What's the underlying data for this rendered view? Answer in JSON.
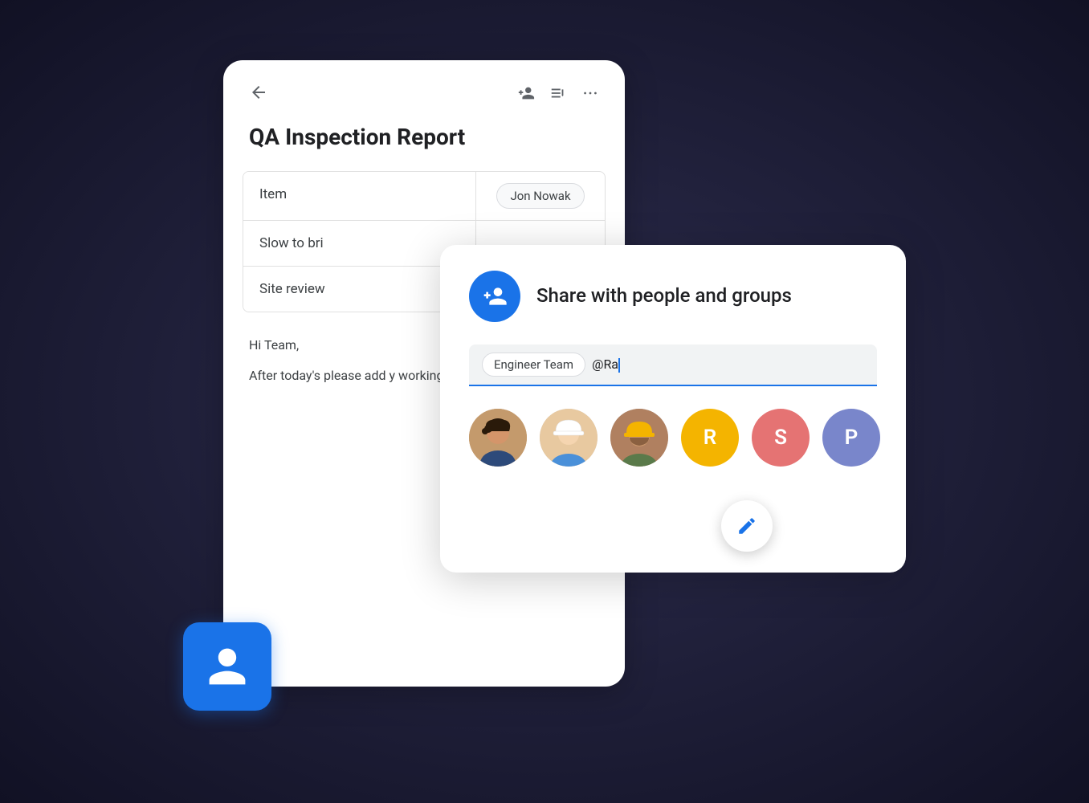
{
  "scene": {
    "bg_card": {
      "title": "QA Inspection Report",
      "table": {
        "rows": [
          {
            "left": "Item",
            "right": "Jon Nowak"
          },
          {
            "left": "Slow to bri",
            "right": ""
          },
          {
            "left": "Site review",
            "right": ""
          }
        ]
      },
      "body": {
        "greeting": "Hi Team,",
        "paragraph": "After today's please add y working doc before next week."
      }
    },
    "share_dialog": {
      "title": "Share with people and groups",
      "input": {
        "tag": "Engineer Team",
        "typed": "@Ra"
      },
      "avatars": [
        {
          "type": "photo",
          "id": "a",
          "label": "Person A"
        },
        {
          "type": "photo",
          "id": "b",
          "label": "Person B"
        },
        {
          "type": "photo",
          "id": "c",
          "label": "Person C"
        },
        {
          "type": "initial",
          "id": "r",
          "initial": "R",
          "color": "#f4b400"
        },
        {
          "type": "initial",
          "id": "s",
          "initial": "S",
          "color": "#e57373"
        },
        {
          "type": "initial",
          "id": "p",
          "initial": "P",
          "color": "#7986cb"
        }
      ]
    },
    "fab": {
      "label": "Edit"
    },
    "blue_card": {
      "label": "Person Icon"
    }
  },
  "icons": {
    "back": "←",
    "add_person": "person_add",
    "notes": "notes",
    "more": "⋯"
  }
}
